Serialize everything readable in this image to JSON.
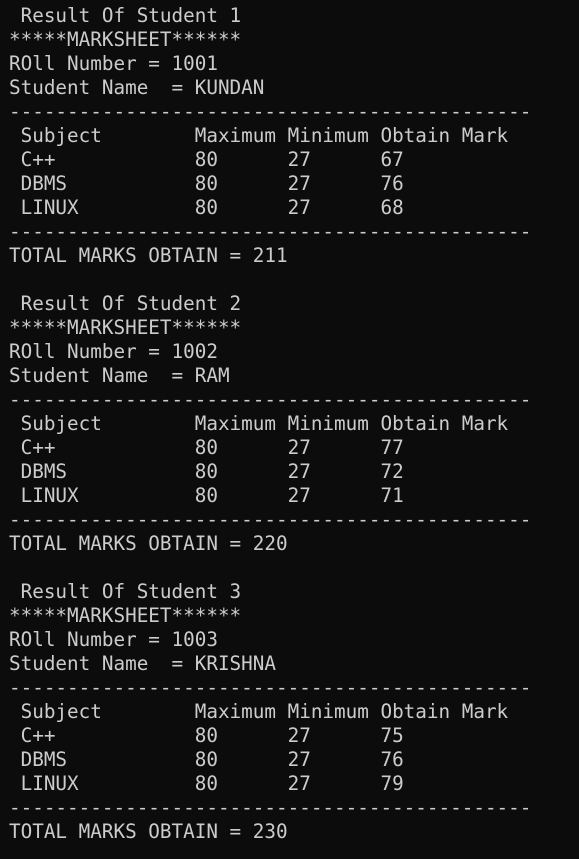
{
  "window": {
    "colors": {
      "background": "#0c0c0c",
      "text": "#cccccc"
    }
  },
  "console": {
    "lines": [
      " Result Of Student 1",
      "*****MARKSHEET******",
      "ROll Number = 1001",
      "Student Name  = KUNDAN",
      "---------------------------------------------",
      " Subject        Maximum Minimum Obtain Mark",
      " C++            80      27      67",
      " DBMS           80      27      76",
      " LINUX          80      27      68",
      "---------------------------------------------",
      "TOTAL MARKS OBTAIN = 211",
      "",
      " Result Of Student 2",
      "*****MARKSHEET******",
      "ROll Number = 1002",
      "Student Name  = RAM",
      "---------------------------------------------",
      " Subject        Maximum Minimum Obtain Mark",
      " C++            80      27      77",
      " DBMS           80      27      72",
      " LINUX          80      27      71",
      "---------------------------------------------",
      "TOTAL MARKS OBTAIN = 220",
      "",
      " Result Of Student 3",
      "*****MARKSHEET******",
      "ROll Number = 1003",
      "Student Name  = KRISHNA",
      "---------------------------------------------",
      " Subject        Maximum Minimum Obtain Mark",
      " C++            80      27      75",
      " DBMS           80      27      76",
      " LINUX          80      27      79",
      "---------------------------------------------",
      "TOTAL MARKS OBTAIN = 230"
    ]
  }
}
